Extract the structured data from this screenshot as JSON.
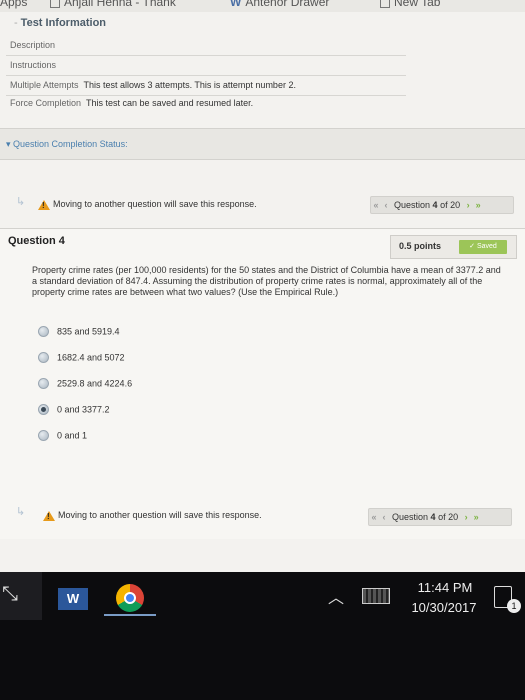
{
  "bookmarks": [
    {
      "label": "Apps",
      "kind": "text"
    },
    {
      "label": "Anjali Henna - Thank",
      "kind": "folder"
    },
    {
      "label": "Antenor Drawer",
      "kind": "w-icon"
    },
    {
      "label": "New Tab",
      "kind": "folder"
    }
  ],
  "test_info": {
    "title": "Test Information",
    "rows": [
      {
        "label": "Description",
        "value": ""
      },
      {
        "label": "Instructions",
        "value": ""
      },
      {
        "label": "Multiple Attempts",
        "value": "This test allows 3 attempts. This is attempt number 2."
      },
      {
        "label": "Force Completion",
        "value": "This test can be saved and resumed later."
      }
    ]
  },
  "completion_status": {
    "label": "Question Completion Status:"
  },
  "nav_top": {
    "warning": "Moving to another question will save this response.",
    "question_prefix": "Question",
    "current": "4",
    "of_label": "of 20"
  },
  "question": {
    "title": "Question 4",
    "points": "0.5 points",
    "saved_label": "Saved",
    "text": "Property crime rates (per 100,000 residents) for the 50 states and the District of Columbia have a mean of 3377.2 and a standard deviation of 847.4. Assuming the distribution of property crime rates is normal, approximately all of the property crime rates are between what two values? (Use the Empirical Rule.)",
    "choices": [
      {
        "label": "835 and 5919.4",
        "selected": false
      },
      {
        "label": "1682.4 and 5072",
        "selected": false
      },
      {
        "label": "2529.8 and 4224.6",
        "selected": false
      },
      {
        "label": "0 and 3377.2",
        "selected": true
      },
      {
        "label": "0 and 1",
        "selected": false
      }
    ]
  },
  "nav_bottom": {
    "warning": "Moving to another question will save this response.",
    "question_prefix": "Question",
    "current": "4",
    "of_label": "of 20"
  },
  "taskbar": {
    "time": "11:44 PM",
    "date": "10/30/2017",
    "notification_count": "1",
    "word_label": "W",
    "icons": [
      "start-icon",
      "word-icon",
      "chrome-icon",
      "chevron-up-icon",
      "keyboard-icon",
      "notification-icon"
    ]
  },
  "colors": {
    "warning": "#e79a1a",
    "saved": "#9cc558",
    "link": "#4a7fae",
    "taskbar": "#0c0c0e"
  }
}
